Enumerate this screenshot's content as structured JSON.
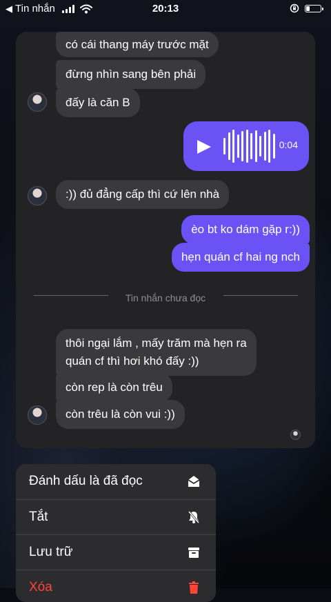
{
  "status_bar": {
    "back_label": "Tin nhắn",
    "time": "20:13"
  },
  "messages": {
    "m1": "có cái thang máy trước mặt",
    "m2": "đừng nhìn sang bên phải",
    "m3": "đấy là căn B",
    "voice_duration": "0:04",
    "m4": ":)) đủ đẳng cấp thì cứ lên nhà",
    "m5": "èo bt ko dám gặp r:))",
    "m6": "hẹn quán cf hai ng nch",
    "unread_divider": "Tin nhắn chưa đọc",
    "m7_line1": "thôi ngại lắm , mấy trăm mà hẹn ra",
    "m7_line2": "quán cf thì hơi khó đấy :))",
    "m8": "còn rep là còn trêu",
    "m9": "còn trêu là còn vui :))"
  },
  "menu": {
    "mark_read": "Đánh dấu là đã đọc",
    "mute": "Tắt",
    "archive": "Lưu trữ",
    "delete": "Xóa"
  },
  "colors": {
    "outgoing_bubble": "#6b52f5",
    "incoming_bubble": "#3a3a3d",
    "delete_red": "#ff453a"
  }
}
